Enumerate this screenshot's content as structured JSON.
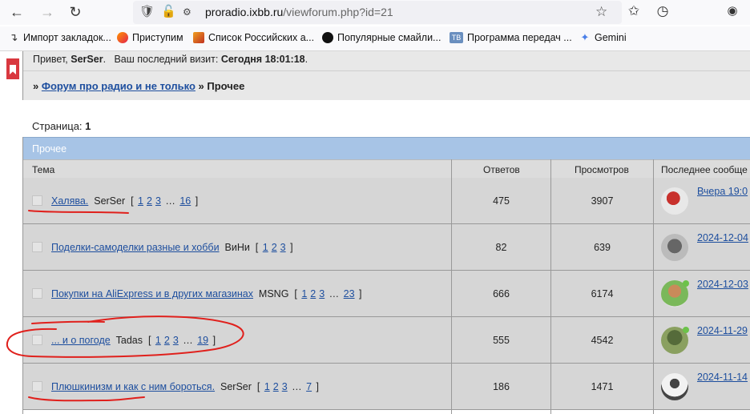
{
  "browser": {
    "url_host": "proradio.ixbb.ru",
    "url_path": "/viewforum.php?id=21",
    "bookmarks": [
      {
        "label": "Импорт закладок...",
        "icon": "import-icon"
      },
      {
        "label": "Приступим",
        "icon": "firefox-icon"
      },
      {
        "label": "Список Российских а...",
        "icon": "site-favicon"
      },
      {
        "label": "Популярные смайли...",
        "icon": "site-favicon"
      },
      {
        "label": "Программа передач ...",
        "icon": "tv-icon",
        "badge": "ТВ"
      },
      {
        "label": "Gemini",
        "icon": "gemini-icon"
      }
    ]
  },
  "header": {
    "welcome_prefix": "Привет, ",
    "username": "SerSer",
    "welcome_mid": ".   Ваш последний визит: ",
    "last_visit": "Сегодня 18:01:18",
    "welcome_suffix": "."
  },
  "breadcrumb": {
    "sep": "»",
    "forum_link": "Форум про радио и не только",
    "current": "Прочее"
  },
  "pagination": {
    "label": "Страница:",
    "current": "1"
  },
  "category": {
    "title": "Прочее"
  },
  "columns": {
    "topic": "Тема",
    "replies": "Ответов",
    "views": "Просмотров",
    "last_post": "Последнее сообще"
  },
  "topics": [
    {
      "title": "Халява.",
      "author": "SerSer",
      "pages": [
        "1",
        "2",
        "3",
        "…",
        "16"
      ],
      "replies": "475",
      "views": "3907",
      "last_date": "Вчера 19:0",
      "online": false
    },
    {
      "title": "Поделки-самоделки разные и хобби",
      "author": "ВиНи",
      "pages": [
        "1",
        "2",
        "3"
      ],
      "replies": "82",
      "views": "639",
      "last_date": "2024-12-04",
      "online": false
    },
    {
      "title": "Покупки на AliExpress и в других магазинах",
      "author": "MSNG",
      "pages": [
        "1",
        "2",
        "3",
        "…",
        "23"
      ],
      "replies": "666",
      "views": "6174",
      "last_date": "2024-12-03",
      "online": true
    },
    {
      "title": "... и о погоде",
      "author": "Tadas",
      "pages": [
        "1",
        "2",
        "3",
        "…",
        "19"
      ],
      "replies": "555",
      "views": "4542",
      "last_date": "2024-11-29",
      "online": true
    },
    {
      "title": "Плюшкинизм и как с ним бороться.",
      "author": "SerSer",
      "pages": [
        "1",
        "2",
        "3",
        "…",
        "7"
      ],
      "replies": "186",
      "views": "1471",
      "last_date": "2024-11-14",
      "online": false
    }
  ],
  "colors": {
    "link": "#1d4e9e",
    "category_bar": "#a7c4e6",
    "row_bg": "#d6d6d6",
    "scribble": "#e0201c"
  }
}
